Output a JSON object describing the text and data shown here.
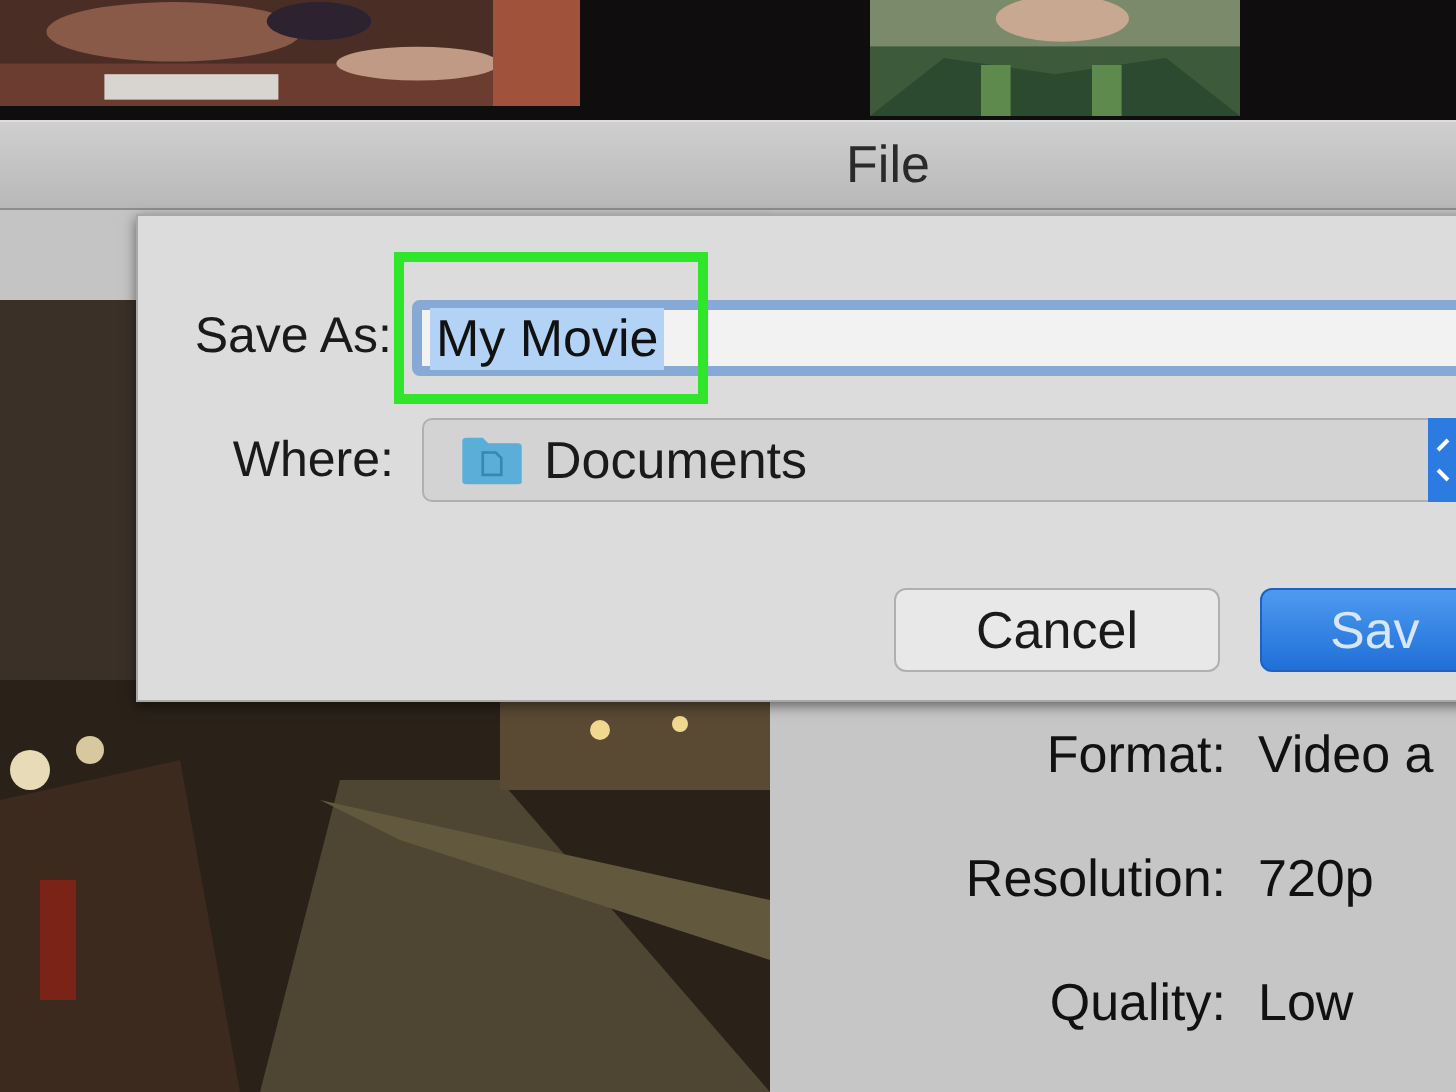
{
  "window": {
    "title": "File"
  },
  "save_dialog": {
    "save_as": {
      "label": "Save As:",
      "value": "My Movie",
      "selected": true,
      "highlighted": true
    },
    "where": {
      "label": "Where:",
      "value": "Documents"
    },
    "buttons": [
      {
        "label": "Cancel",
        "kind": "secondary"
      },
      {
        "label": "Sav",
        "kind": "primary"
      }
    ]
  },
  "settings": [
    {
      "label": "Format:",
      "value": "Video a"
    },
    {
      "label": "Resolution:",
      "value": "720p"
    },
    {
      "label": "Quality:",
      "value": "Low"
    }
  ]
}
